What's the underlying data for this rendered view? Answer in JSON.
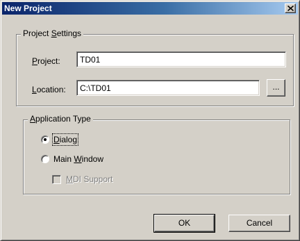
{
  "window": {
    "title": "New Project",
    "close_label": "×"
  },
  "project_settings": {
    "legend": {
      "pre": "Project ",
      "mnemonic": "S",
      "post": "ettings"
    },
    "project_label": {
      "pre": "",
      "mnemonic": "P",
      "post": "roject:"
    },
    "project_value": "TD01",
    "location_label": {
      "pre": "",
      "mnemonic": "L",
      "post": "ocation:"
    },
    "location_value": "C:\\TD01",
    "browse_label": "..."
  },
  "application_type": {
    "legend": {
      "pre": "",
      "mnemonic": "A",
      "post": "pplication Type"
    },
    "options": [
      {
        "pre": "",
        "mnemonic": "D",
        "post": "ialog",
        "selected": true
      },
      {
        "pre": "Main ",
        "mnemonic": "W",
        "post": "indow",
        "selected": false
      }
    ],
    "mdi_support": {
      "pre": "",
      "mnemonic": "M",
      "post": "DI Support",
      "checked": false,
      "enabled": false
    }
  },
  "buttons": {
    "ok": "OK",
    "cancel": "Cancel"
  }
}
